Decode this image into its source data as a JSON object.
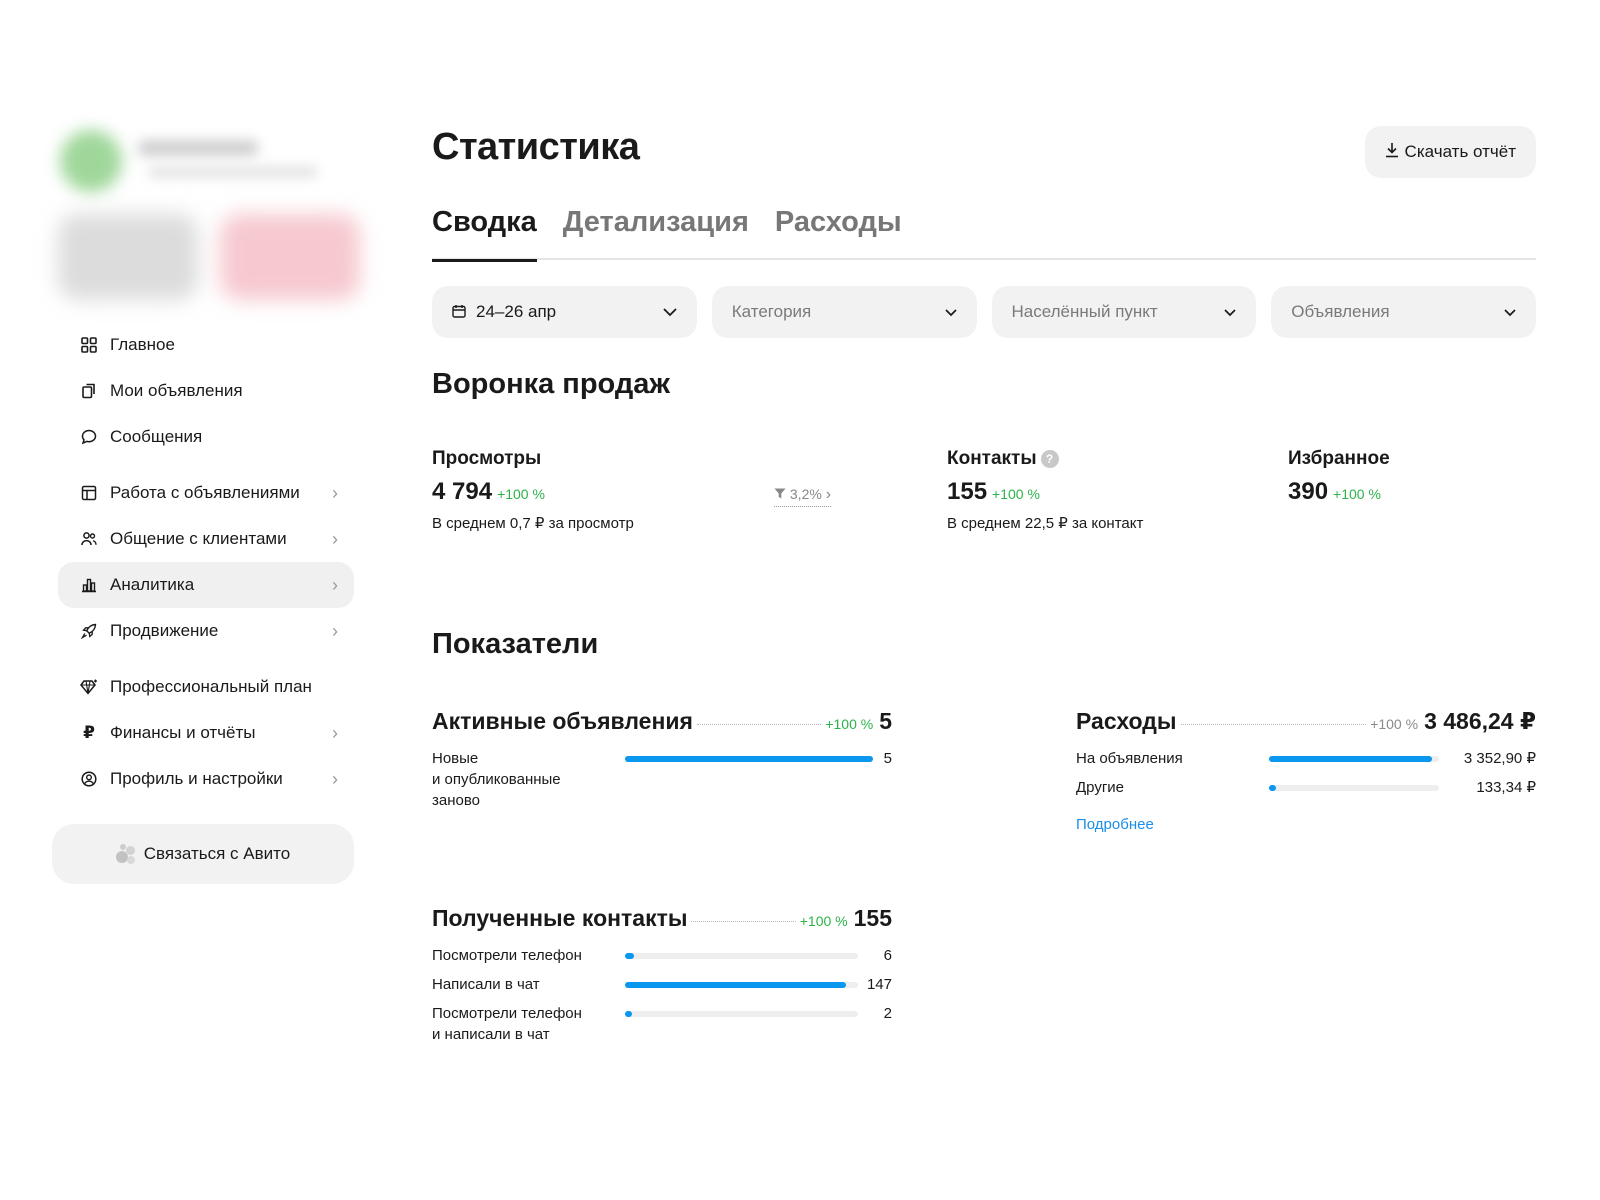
{
  "sidebar": {
    "items": [
      {
        "label": "Главное",
        "icon": "grid-icon",
        "chevron": false
      },
      {
        "label": "Мои объявления",
        "icon": "copy-icon",
        "chevron": false
      },
      {
        "label": "Сообщения",
        "icon": "chat-icon",
        "chevron": false
      },
      {
        "label": "Работа с объявлениями",
        "icon": "layout-icon",
        "chevron": true
      },
      {
        "label": "Общение с клиентами",
        "icon": "users-icon",
        "chevron": true
      },
      {
        "label": "Аналитика",
        "icon": "bar-chart-icon",
        "chevron": true,
        "active": true
      },
      {
        "label": "Продвижение",
        "icon": "rocket-icon",
        "chevron": true
      },
      {
        "label": "Профессиональный план",
        "icon": "diamond-icon",
        "chevron": false
      },
      {
        "label": "Финансы и отчёты",
        "icon": "ruble-icon",
        "chevron": true
      },
      {
        "label": "Профиль и настройки",
        "icon": "user-circle-icon",
        "chevron": true
      }
    ],
    "contact_label": "Связаться с Авито"
  },
  "header": {
    "title": "Статистика",
    "download_label": "Скачать отчёт"
  },
  "tabs": [
    {
      "label": "Сводка",
      "active": true
    },
    {
      "label": "Детализация",
      "active": false
    },
    {
      "label": "Расходы",
      "active": false
    }
  ],
  "filters": {
    "date": "24–26 апр",
    "category": "Категория",
    "locality": "Населённый пункт",
    "ads": "Объявления"
  },
  "funnel": {
    "title": "Воронка продаж",
    "views": {
      "label": "Просмотры",
      "value": "4 794",
      "change": "+100 %",
      "sub": "В среднем 0,7 ₽ за просмотр"
    },
    "conversion": "3,2%",
    "contacts": {
      "label": "Контакты",
      "help": "?",
      "value": "155",
      "change": "+100 %",
      "sub": "В среднем 22,5 ₽ за контакт"
    },
    "favorites": {
      "label": "Избранное",
      "value": "390",
      "change": "+100 %"
    }
  },
  "indicators": {
    "title": "Показатели",
    "active_ads": {
      "title": "Активные объявления",
      "change": "+100 %",
      "value": "5",
      "rows": [
        {
          "label": "Новые\nи опубликованные\nзаново",
          "value": "5",
          "fraction": 1.0
        }
      ]
    },
    "expenses": {
      "title": "Расходы",
      "change": "+100 %",
      "value": "3 486,24 ₽",
      "rows": [
        {
          "label": "На объявления",
          "value": "3 352,90 ₽",
          "fraction": 0.96
        },
        {
          "label": "Другие",
          "value": "133,34 ₽",
          "fraction": 0.04
        }
      ],
      "more_link": "Подробнее"
    },
    "contacts": {
      "title": "Полученные контакты",
      "change": "+100 %",
      "value": "155",
      "rows": [
        {
          "label": "Посмотрели телефон",
          "value": "6",
          "fraction": 0.04
        },
        {
          "label": "Написали в чат",
          "value": "147",
          "fraction": 0.95
        },
        {
          "label": "Посмотрели телефон\nи написали в чат",
          "value": "2",
          "fraction": 0.02
        }
      ]
    }
  },
  "colors": {
    "accent_blue": "#0a97f0",
    "positive_green": "#2db34a",
    "link_blue": "#1a8ee8"
  }
}
